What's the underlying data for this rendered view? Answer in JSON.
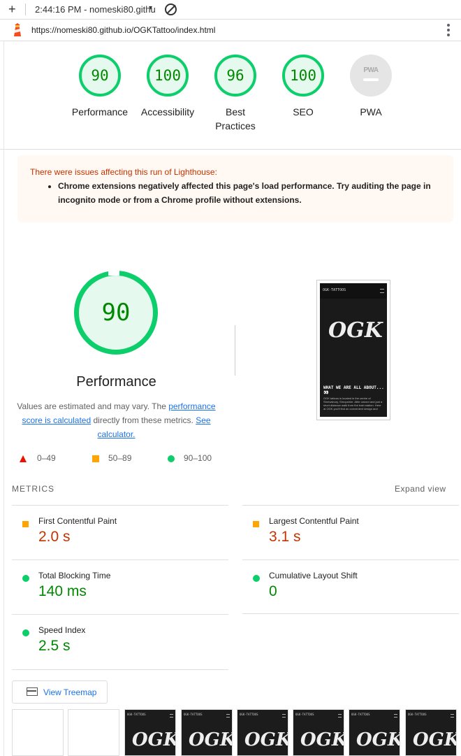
{
  "topbar": {
    "time_title": "2:44:16 PM - nomeski80.githu",
    "dropdown_glyph": "▾",
    "plus_glyph": "+"
  },
  "urlbar": {
    "url": "https://nomeski80.github.io/OGKTattoo/index.html"
  },
  "gauges": [
    {
      "score": "90",
      "label": "Performance"
    },
    {
      "score": "100",
      "label": "Accessibility"
    },
    {
      "score": "96",
      "label": "Best Practices"
    },
    {
      "score": "100",
      "label": "SEO"
    },
    {
      "score": "",
      "label": "PWA",
      "badge": "PWA"
    }
  ],
  "warning": {
    "heading": "There were issues affecting this run of Lighthouse:",
    "item": "Chrome extensions negatively affected this page's load performance. Try auditing the page in incognito mode or from a Chrome profile without extensions."
  },
  "performance": {
    "score": "90",
    "title": "Performance",
    "note_prefix": "Values are estimated and may vary. The ",
    "note_link": "performance score is calculated",
    "note_mid": " directly from these metrics. ",
    "note_link2": "See calculator."
  },
  "screenshot": {
    "nav_text": "OGK-TATTOOS",
    "brand": "OGK",
    "about": "WHAT WE ARE ALL ABOUT... 👀",
    "body": "OGK tattoos is located in the centre of Shrewsbury, Shropshire. After owned and just a short distance walk from the train station. Here at OGK you'll find an convenient design and"
  },
  "legend": [
    {
      "range": "0–49",
      "color": "#eb0f00"
    },
    {
      "range": "50–89",
      "color": "#ffa400"
    },
    {
      "range": "90–100",
      "color": "#0cce6b"
    }
  ],
  "metrics": {
    "header": "METRICS",
    "expand": "Expand view",
    "items": [
      {
        "name": "First Contentful Paint",
        "value": "2.0 s",
        "status": "average"
      },
      {
        "name": "Largest Contentful Paint",
        "value": "3.1 s",
        "status": "average"
      },
      {
        "name": "Total Blocking Time",
        "value": "140 ms",
        "status": "pass"
      },
      {
        "name": "Cumulative Layout Shift",
        "value": "0",
        "status": "pass"
      },
      {
        "name": "Speed Index",
        "value": "2.5 s",
        "status": "pass"
      }
    ]
  },
  "treemap": {
    "label": "View Treemap"
  },
  "filmstrip": {
    "frame_label": "OGK-TATTOOS",
    "brand": "OGK"
  }
}
